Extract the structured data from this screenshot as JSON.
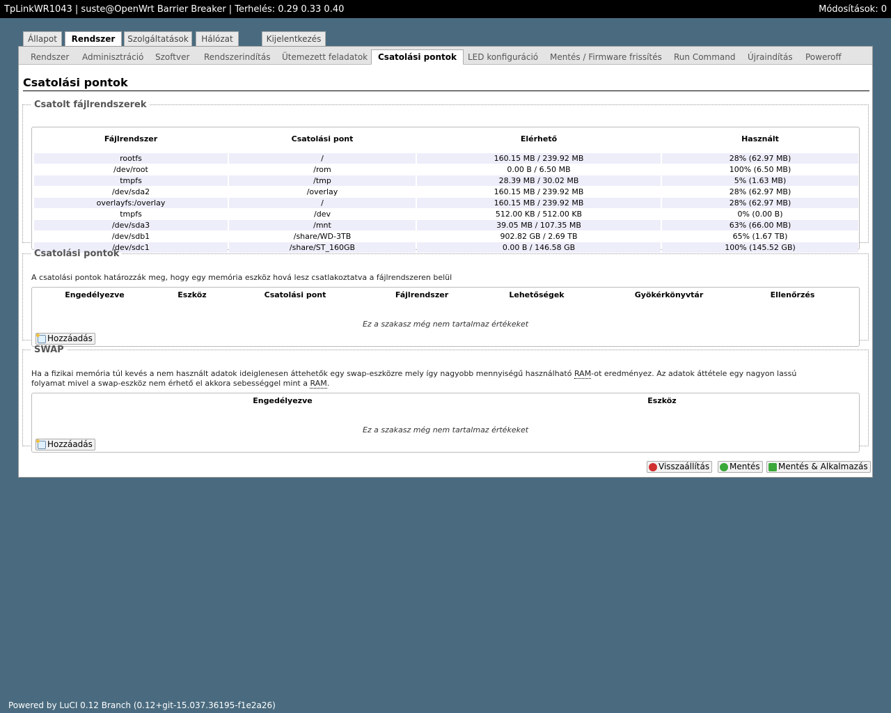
{
  "topbar": {
    "title": "TpLinkWR1043 | suste@OpenWrt Barrier Breaker | Terhelés: 0.29 0.33 0.40",
    "changes": "Módosítások: 0"
  },
  "main_tabs": [
    "Állapot",
    "Rendszer",
    "Szolgáltatások",
    "Hálózat",
    "Kijelentkezés"
  ],
  "sub_tabs": [
    "Rendszer",
    "Adminisztráció",
    "Szoftver",
    "Rendszerindítás",
    "Ütemezett feladatok",
    "Csatolási pontok",
    "LED konfiguráció",
    "Mentés / Firmware frissítés",
    "Run Command",
    "Újraindítás",
    "Poweroff"
  ],
  "page": {
    "title": "Csatolási pontok"
  },
  "mounted": {
    "legend": "Csatolt fájlrendszerek",
    "headers": [
      "Fájlrendszer",
      "Csatolási pont",
      "Elérhető",
      "Használt"
    ],
    "rows": [
      [
        "rootfs",
        "/",
        "160.15 MB / 239.92 MB",
        "28% (62.97 MB)"
      ],
      [
        "/dev/root",
        "/rom",
        "0.00 B / 6.50 MB",
        "100% (6.50 MB)"
      ],
      [
        "tmpfs",
        "/tmp",
        "28.39 MB / 30.02 MB",
        "5% (1.63 MB)"
      ],
      [
        "/dev/sda2",
        "/overlay",
        "160.15 MB / 239.92 MB",
        "28% (62.97 MB)"
      ],
      [
        "overlayfs:/overlay",
        "/",
        "160.15 MB / 239.92 MB",
        "28% (62.97 MB)"
      ],
      [
        "tmpfs",
        "/dev",
        "512.00 KB / 512.00 KB",
        "0% (0.00 B)"
      ],
      [
        "/dev/sda3",
        "/mnt",
        "39.05 MB / 107.35 MB",
        "63% (66.00 MB)"
      ],
      [
        "/dev/sdb1",
        "/share/WD-3TB",
        "902.82 GB / 2.69 TB",
        "65% (1.67 TB)"
      ],
      [
        "/dev/sdc1",
        "/share/ST_160GB",
        "0.00 B / 146.58 GB",
        "100% (145.52 GB)"
      ]
    ]
  },
  "mountpoints": {
    "legend": "Csatolási pontok",
    "description": "A csatolási pontok határozzák meg, hogy egy memória eszköz hová lesz csatlakoztatva a fájlrendszeren belül",
    "headers": [
      "Engedélyezve",
      "Eszköz",
      "Csatolási pont",
      "Fájlrendszer",
      "Lehetőségek",
      "Gyökérkönyvtár",
      "Ellenőrzés"
    ],
    "empty": "Ez a szakasz még nem tartalmaz értékeket",
    "add_label": "Hozzáadás"
  },
  "swap": {
    "legend": "SWAP",
    "desc_1": "Ha a fizikai memória túl kevés a nem használt adatok ideiglenesen áttehetők egy swap-eszközre mely így nagyobb mennyiségű használható ",
    "ram": "RAM",
    "desc_2": "-ot eredményez. Az adatok áttétele egy nagyon lassú",
    "desc_3": "folyamat mivel a swap-eszköz nem érhető el akkora sebességgel mint a ",
    "desc_4": ".",
    "headers": [
      "Engedélyezve",
      "Eszköz"
    ],
    "empty": "Ez a szakasz még nem tartalmaz értékeket",
    "add_label": "Hozzáadás"
  },
  "actions": {
    "reset": "Visszaállítás",
    "save": "Mentés",
    "save_apply": "Mentés & Alkalmazás"
  },
  "footer": "Powered by LuCI 0.12 Branch (0.12+git-15.037.36195-f1e2a26)"
}
